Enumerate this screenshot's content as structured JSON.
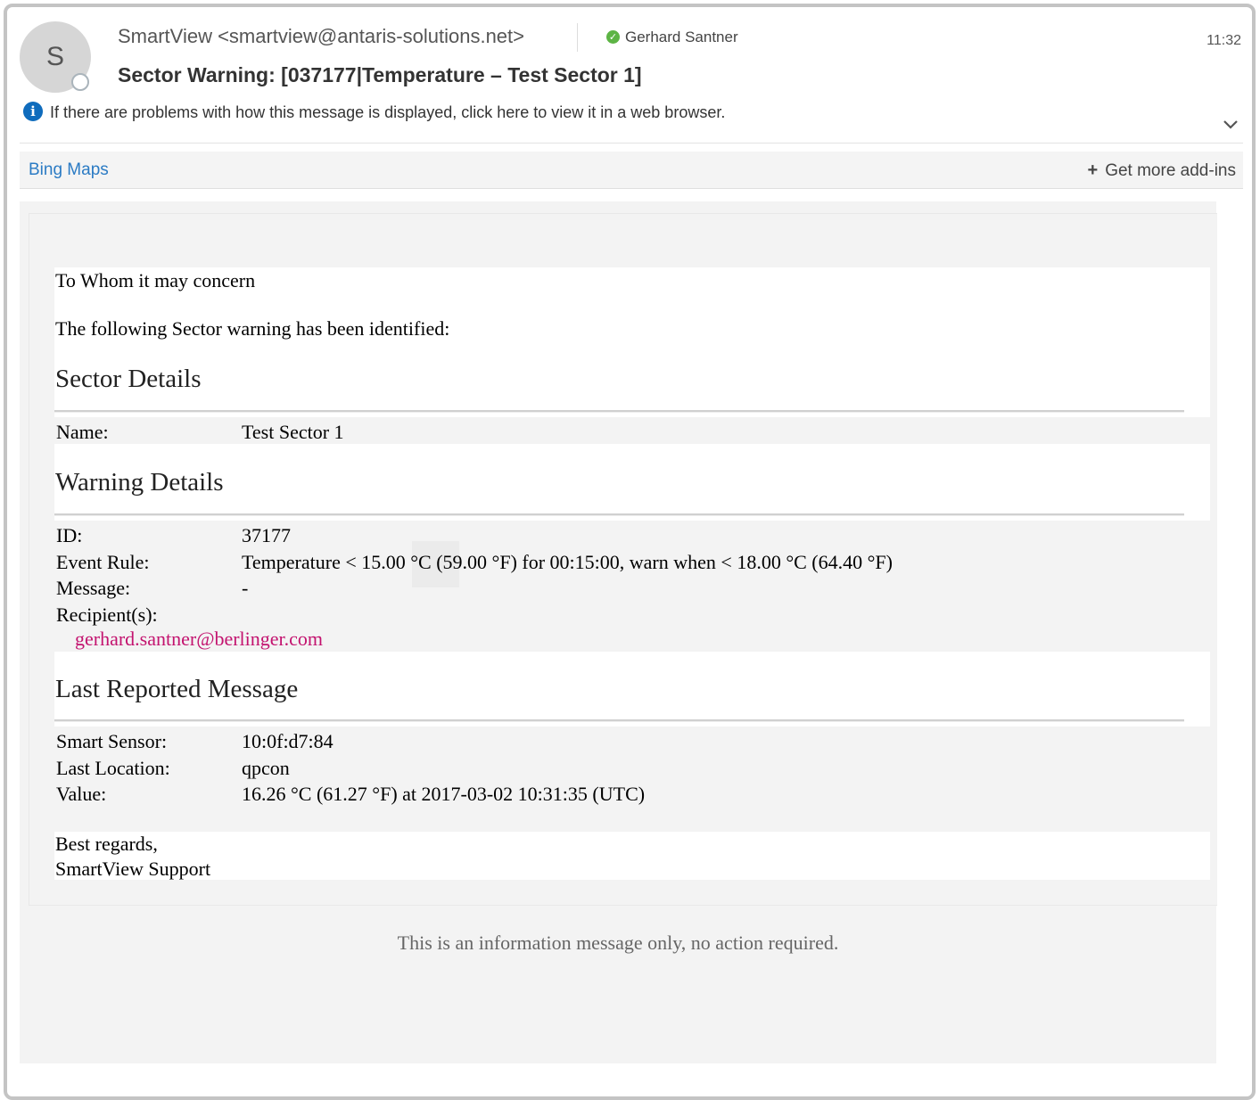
{
  "header": {
    "avatar_initial": "S",
    "sender": "SmartView <smartview@antaris-solutions.net>",
    "recipient": "Gerhard Santner",
    "time": "11:32",
    "subject": "Sector Warning: [037177|Temperature – Test Sector 1]",
    "info_text": "If there are problems with how this message is displayed, click here to view it in a web browser."
  },
  "addins": {
    "bing_label": "Bing Maps",
    "more_label": "Get more add-ins"
  },
  "body": {
    "greeting": "To Whom it may concern",
    "intro": "The following Sector warning has been identified:",
    "sector_heading": "Sector Details",
    "sector": [
      {
        "label": "Name:",
        "value": "Test Sector 1"
      }
    ],
    "warning_heading": "Warning Details",
    "warning": [
      {
        "label": "ID:",
        "value": "37177"
      },
      {
        "label": "Event Rule:",
        "value": "Temperature < 15.00 °C (59.00 °F) for 00:15:00, warn when < 18.00 °C (64.40 °F)"
      },
      {
        "label": "Message:",
        "value": "-"
      },
      {
        "label": "Recipient(s):",
        "value": ""
      }
    ],
    "recipient_email": "gerhard.santner@berlinger.com",
    "last_heading": "Last Reported Message",
    "last": [
      {
        "label": "Smart Sensor:",
        "value": "10:0f:d7:84"
      },
      {
        "label": "Last Location:",
        "value": "qpcon"
      },
      {
        "label": "Value:",
        "value": "16.26 °C (61.27 °F) at 2017-03-02 10:31:35 (UTC)"
      }
    ],
    "closing": "Best regards,",
    "signature": "SmartView Support",
    "footer_note": "This is an information message only, no action required."
  },
  "colors": {
    "link": "#c3136f",
    "bing": "#2b7bc4",
    "info_icon": "#0f6cbd",
    "presence_ok": "#5db445"
  }
}
